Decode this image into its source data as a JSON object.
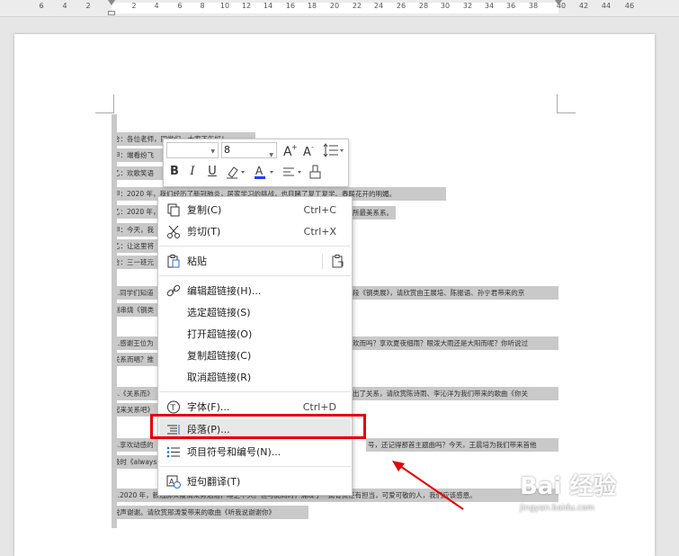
{
  "ruler": {
    "numbers": [
      "6",
      "4",
      "2",
      "2",
      "4",
      "6",
      "8",
      "10",
      "12",
      "14",
      "16",
      "18",
      "20",
      "22",
      "24",
      "26",
      "28",
      "30",
      "32",
      "34",
      "36",
      "38",
      "40",
      "42",
      "44",
      "46"
    ]
  },
  "document": {
    "lines": [
      "合：各位老师，同学们，大家下午好！",
      "甲：端看纷飞",
      "乙：欢歌笑语",
      "甲：2020 年，我们经历了新冠肺炎，居家学习的挑战，也目睹了复工复学、春暖花开的明媚。",
      "乙：2020 年，",
      "甲：今天，我",
      "乙：让这里将",
      "合：三一班元",
      "1.同学们知道",
      "剧串烧《钢类",
      "2.感谢王位为",
      "关系而唱？推",
      "3.《关系而》",
      "起来关系吧》",
      "4.享欢动感的",
      "级时《always",
      "5.2020 年，新冠肺炎疫情来势汹汹，睡之不久。但与此同时，涌现了一批有责任有担当，可爱可敬的人，我们应该感恩。",
      "说声谢谢。请欣赏邢涛爱带来的歌曲《听我说谢谢你》"
    ],
    "right_fragments": [
      "所最美系系。",
      "段《钢类展》，请欣赏由王展培、陈振语、孙宁君带来的京",
      "欢而吗？享欢夏夜细雨？眼泼大雨还是大阳而呢？你听说过",
      "出了关系，请欣赏陈诗雨、李沁洋为我们带来的歌曲《你关",
      "号，还记得那首主题曲吗？今天，王晨培为我们带来首他"
    ]
  },
  "mini_toolbar": {
    "font_name": "",
    "font_size": "8",
    "grow_font": "A⁺",
    "shrink_font": "A⁻",
    "bold": "B",
    "italic": "I",
    "underline": "U"
  },
  "context_menu": {
    "items": [
      {
        "label": "复制(C)",
        "shortcut": "Ctrl+C",
        "icon": "copy-icon"
      },
      {
        "label": "剪切(T)",
        "shortcut": "Ctrl+X",
        "icon": "scissors-icon"
      },
      {
        "label": "粘贴",
        "shortcut": "",
        "icon": "paste-icon"
      },
      {
        "label": "编辑超链接(H)...",
        "shortcut": "",
        "icon": "link-icon"
      },
      {
        "label": "选定超链接(S)",
        "shortcut": "",
        "icon": ""
      },
      {
        "label": "打开超链接(O)",
        "shortcut": "",
        "icon": ""
      },
      {
        "label": "复制超链接(C)",
        "shortcut": "",
        "icon": ""
      },
      {
        "label": "取消超链接(R)",
        "shortcut": "",
        "icon": ""
      },
      {
        "label": "字体(F)...",
        "shortcut": "Ctrl+D",
        "icon": "font-icon"
      },
      {
        "label": "段落(P)...",
        "shortcut": "",
        "icon": "paragraph-icon"
      },
      {
        "label": "项目符号和编号(N)...",
        "shortcut": "",
        "icon": "bullets-icon"
      },
      {
        "label": "短句翻译(T)",
        "shortcut": "",
        "icon": "translate-icon"
      }
    ]
  },
  "colors": {
    "highlight_box": "#e60000",
    "selection": "#c9c9c9"
  },
  "watermark": {
    "brand": "Bai 经验",
    "url": "jingyan.baidu.com"
  }
}
